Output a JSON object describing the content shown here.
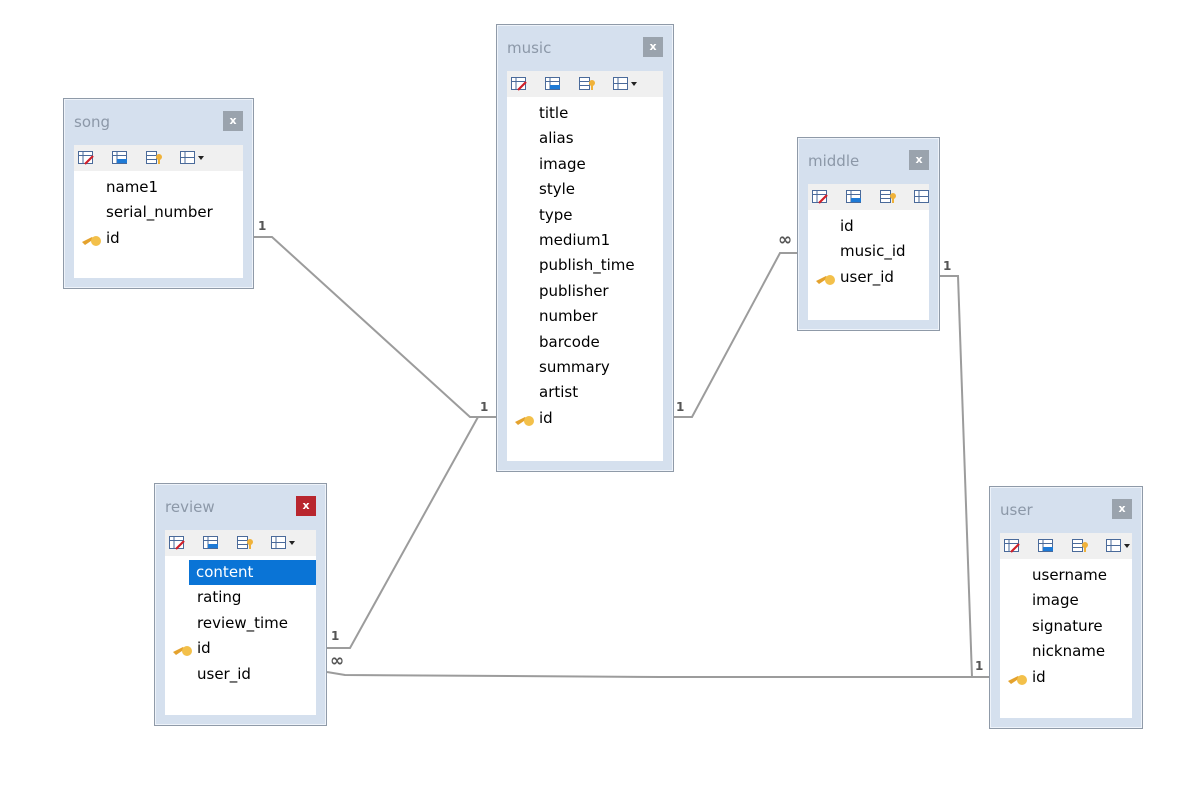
{
  "tables": {
    "song": {
      "title": "song",
      "close": "x",
      "fields": [
        "name1",
        "serial_number",
        "id"
      ],
      "key_fields": [
        "id"
      ]
    },
    "music": {
      "title": "music",
      "close": "x",
      "fields": [
        "title",
        "alias",
        "image",
        "style",
        "type",
        "medium1",
        "publish_time",
        "publisher",
        "number",
        "barcode",
        "summary",
        "artist",
        "id"
      ],
      "key_fields": [
        "id"
      ]
    },
    "middle": {
      "title": "middle",
      "close": "x",
      "fields": [
        "id",
        "music_id",
        "user_id"
      ],
      "key_fields": [
        "user_id"
      ]
    },
    "review": {
      "title": "review",
      "close": "x",
      "fields": [
        "content",
        "rating",
        "review_time",
        "id",
        "user_id"
      ],
      "key_fields": [
        "id"
      ],
      "selected_field": "content"
    },
    "user": {
      "title": "user",
      "close": "x",
      "fields": [
        "username",
        "image",
        "signature",
        "nickname",
        "id"
      ],
      "key_fields": [
        "id"
      ]
    }
  },
  "relationships": [
    {
      "from": "song",
      "from_card": "1",
      "to": "music",
      "to_card": "1"
    },
    {
      "from": "music",
      "from_card": "1",
      "to": "middle",
      "to_card": "∞"
    },
    {
      "from": "review",
      "from_card": "1",
      "to": "music",
      "to_card": "1"
    },
    {
      "from": "middle",
      "from_card": "1",
      "to": "user",
      "to_card": "1"
    },
    {
      "from": "review",
      "from_card": "∞",
      "to": "user",
      "to_card": "1"
    }
  ],
  "toolbar_icons": [
    "design-table-icon",
    "edit-fields-icon",
    "edit-indexes-icon",
    "layout-dropdown-icon"
  ],
  "colors": {
    "table_bg": "#d5e0ee",
    "close_active": "#b8262e",
    "selection": "#0a74d6",
    "key": "#f0b23a",
    "line": "#9c9c9c"
  }
}
